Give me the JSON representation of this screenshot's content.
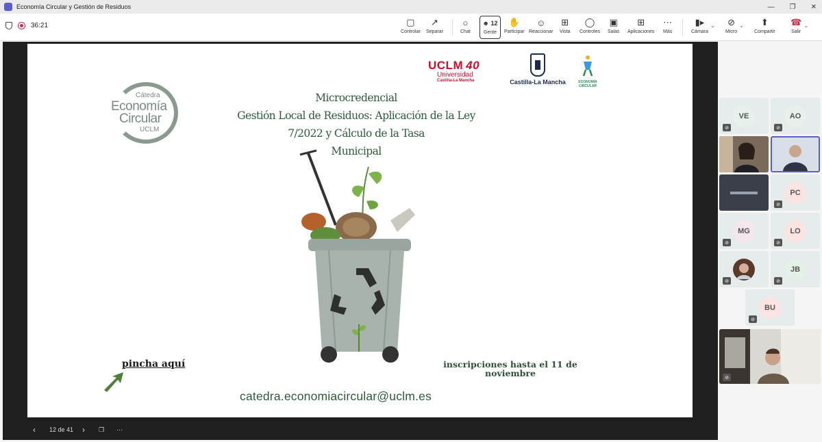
{
  "window": {
    "title": "Economía Circular y Gestión de Residuos"
  },
  "meeting": {
    "timer": "36:21"
  },
  "toolbar": {
    "controlar": "Controlar",
    "separar": "Separar",
    "chat": "Chat",
    "gente": "Gente",
    "gente_count": "12",
    "participar": "Participar",
    "reaccionar": "Reaccionar",
    "vista": "Vista",
    "controles": "Controles",
    "salas": "Salas",
    "aplicaciones": "Aplicaciones",
    "mas": "Más",
    "camara": "Cámara",
    "micro": "Micro",
    "compartir": "Compartir",
    "salir": "Salir"
  },
  "slide": {
    "uclm_big": "UCLM",
    "uclm_40": "40",
    "uclm_sub1": "Universidad",
    "uclm_sub2": "Castilla-La Mancha",
    "clm_text": "Castilla-La Mancha",
    "eco_text1": "ECONOMÍA",
    "eco_text2": "CIRCULAR",
    "catedra_t1": "Cátedra",
    "catedra_t2": "Economía",
    "catedra_t3": "Circular",
    "catedra_t4": "UCLM",
    "headline": {
      "line1": "Microcredencial",
      "line2": "Gestión Local de Residuos: Aplicación de la Ley",
      "line3": "7/2022 y Cálculo de la Tasa",
      "line4": "Municipal"
    },
    "pincha": "pincha aquí",
    "inscripciones_line1": "inscripciones hasta el 11 de",
    "inscripciones_line2": "noviembre",
    "email": "catedra.economiacircular@uclm.es"
  },
  "slide_controls": {
    "counter": "12 de 41"
  },
  "participants": [
    {
      "initials": "VE",
      "color": "#e8f0ec"
    },
    {
      "initials": "AO",
      "color": "#e8f0ec"
    },
    {
      "initials": "PC",
      "color": "#fbe4e2"
    },
    {
      "initials": "MG",
      "color": "#f6e6ee"
    },
    {
      "initials": "LO",
      "color": "#fbe4e2"
    },
    {
      "initials": "JB",
      "color": "#e4f1e6"
    },
    {
      "initials": "BU",
      "color": "#fbe4e2"
    }
  ]
}
